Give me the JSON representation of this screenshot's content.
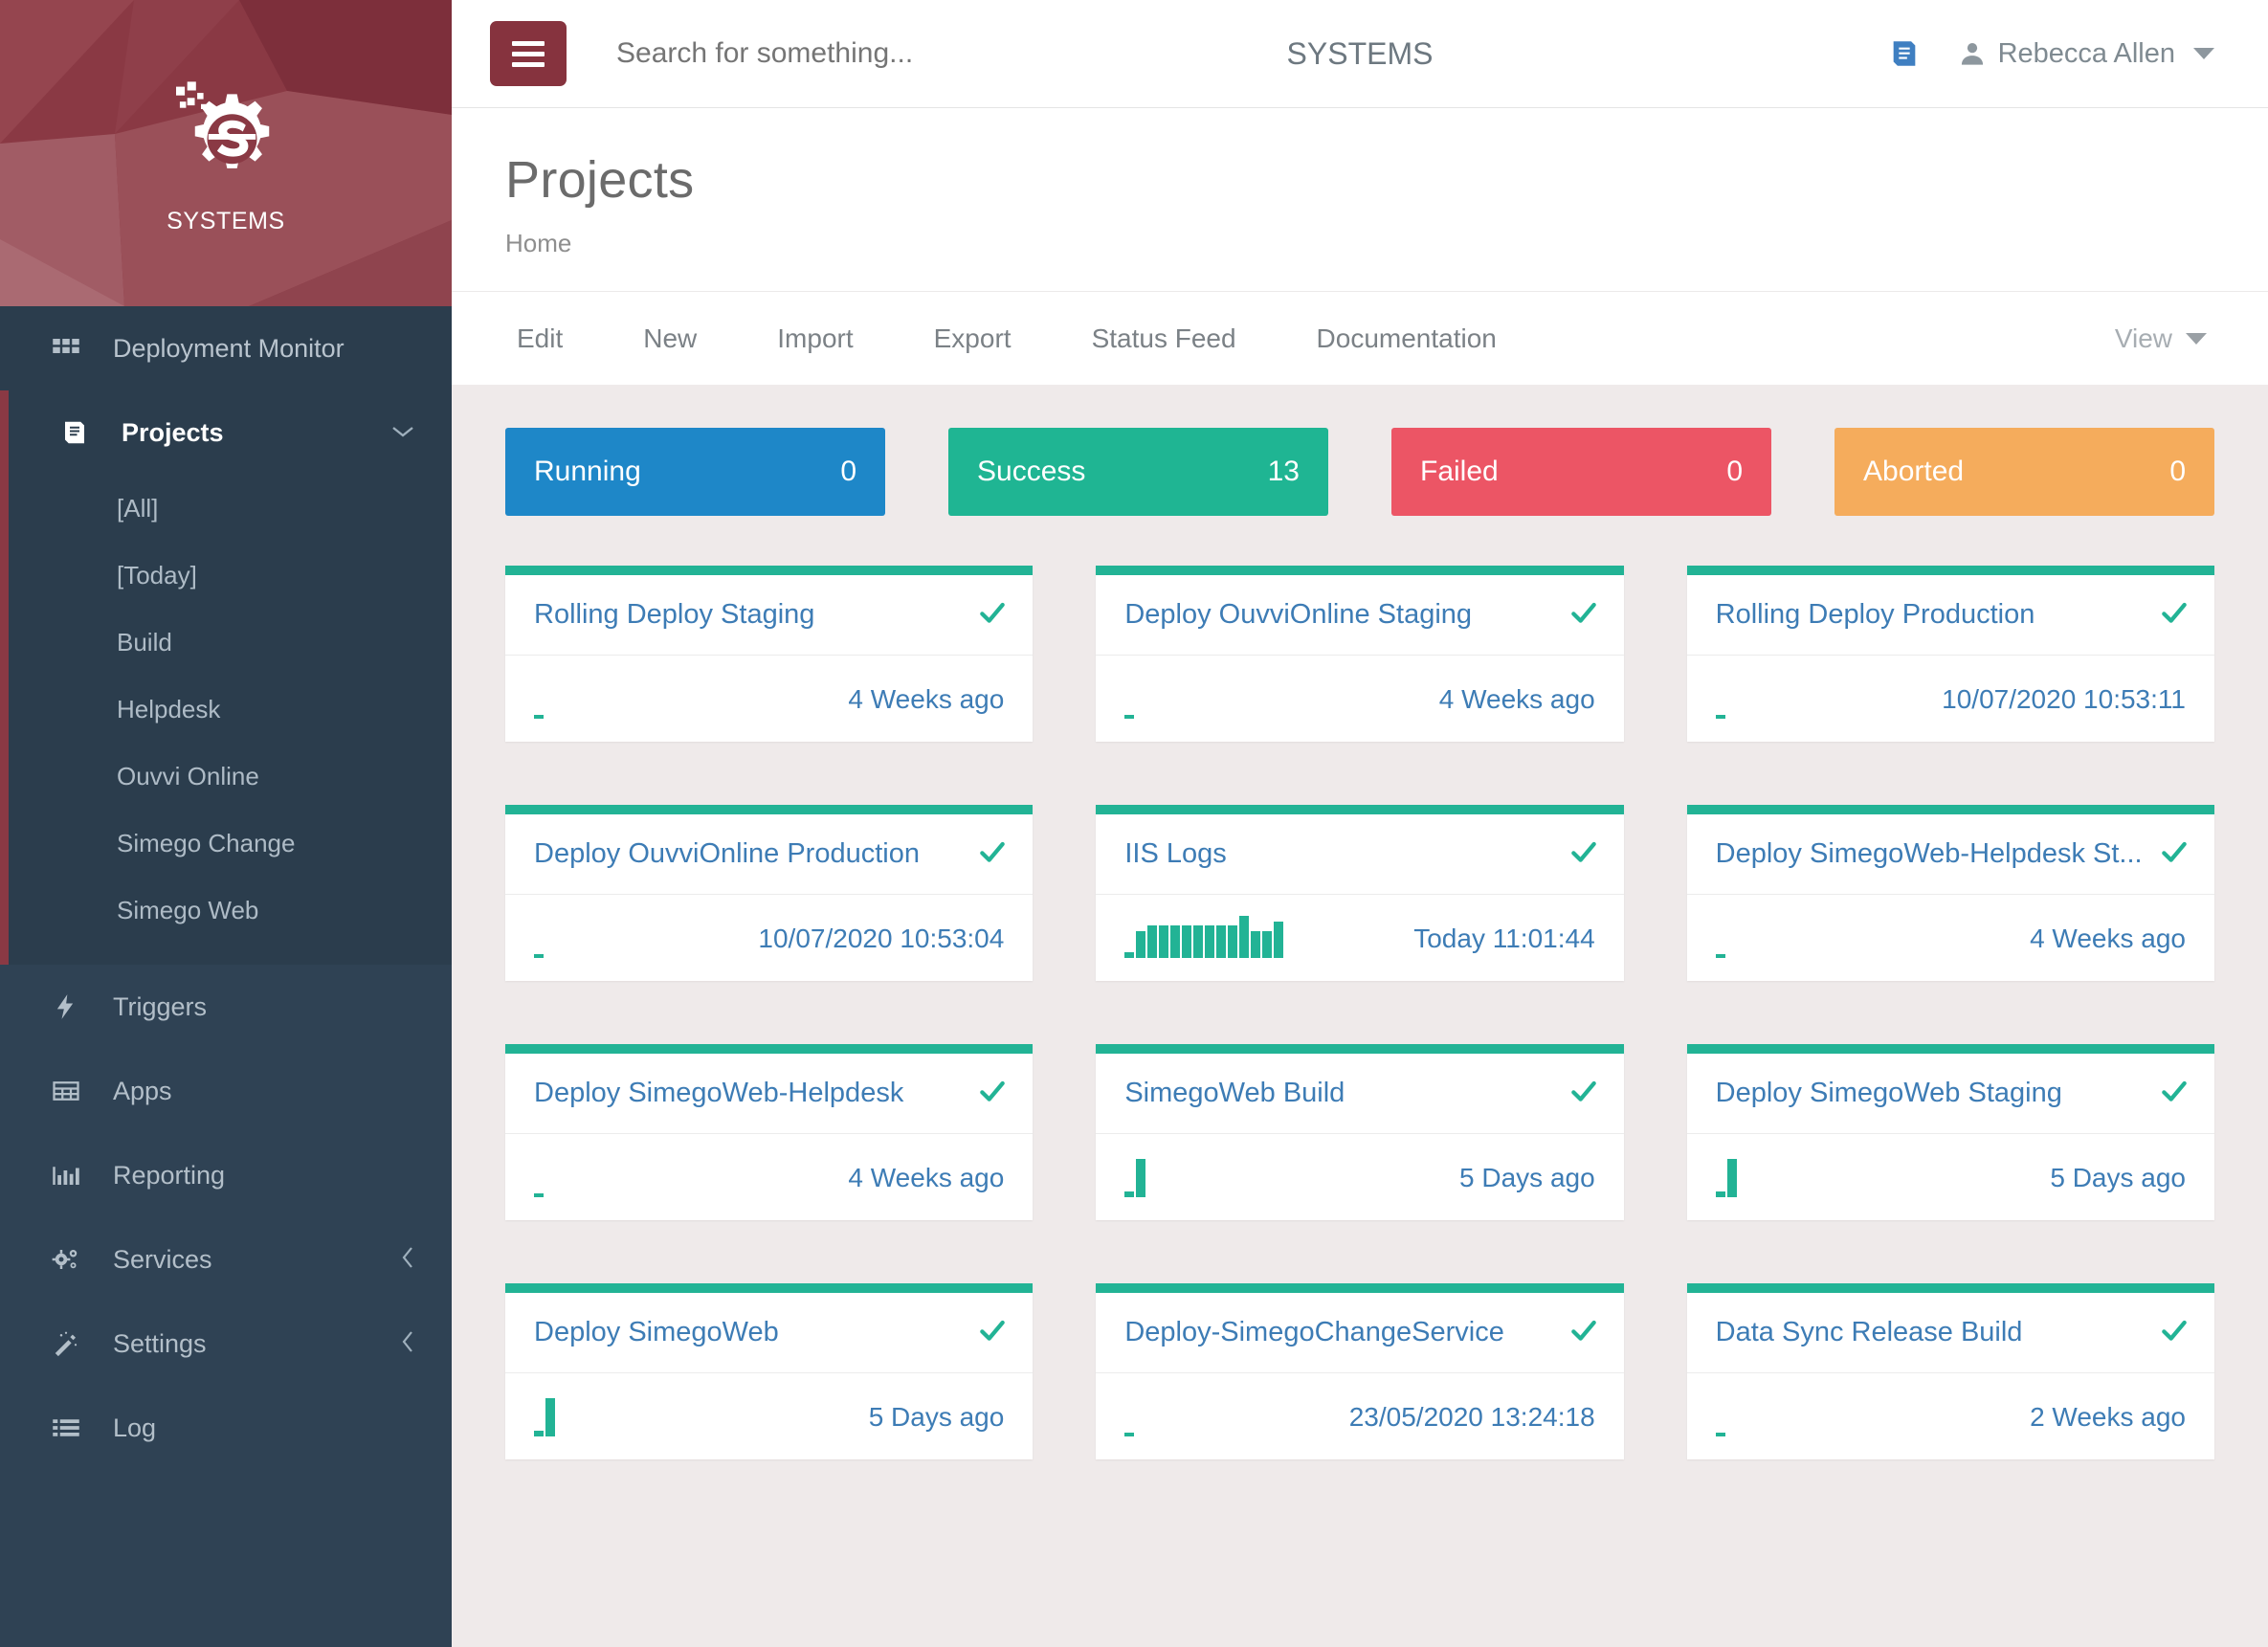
{
  "brand": {
    "name": "SYSTEMS",
    "logo_icon": "gear-s-logo"
  },
  "topbar": {
    "menu_icon": "hamburger-icon",
    "search_placeholder": "Search for something...",
    "search_value": "",
    "center_title": "SYSTEMS",
    "book_icon": "book-icon",
    "user_icon": "user-icon",
    "user_name": "Rebecca Allen",
    "caret_icon": "chevron-down-icon"
  },
  "sidebar": {
    "monitor": {
      "label": "Deployment Monitor",
      "icon": "grid-icon"
    },
    "projects": {
      "label": "Projects",
      "icon": "book-icon",
      "chevron": "chevron-down-icon"
    },
    "project_items": [
      {
        "label": "[All]"
      },
      {
        "label": "[Today]"
      },
      {
        "label": "Build"
      },
      {
        "label": "Helpdesk"
      },
      {
        "label": "Ouvvi Online"
      },
      {
        "label": "Simego Change"
      },
      {
        "label": "Simego Web"
      }
    ],
    "items": [
      {
        "label": "Triggers",
        "icon": "bolt-icon",
        "chevron": ""
      },
      {
        "label": "Apps",
        "icon": "table-icon",
        "chevron": ""
      },
      {
        "label": "Reporting",
        "icon": "bar-chart-icon",
        "chevron": ""
      },
      {
        "label": "Services",
        "icon": "gears-icon",
        "chevron": "chevron-left-icon"
      },
      {
        "label": "Settings",
        "icon": "wand-icon",
        "chevron": "chevron-left-icon"
      },
      {
        "label": "Log",
        "icon": "list-icon",
        "chevron": ""
      }
    ]
  },
  "page": {
    "title": "Projects",
    "breadcrumb": "Home"
  },
  "toolbar": {
    "items": [
      {
        "label": "Edit"
      },
      {
        "label": "New"
      },
      {
        "label": "Import"
      },
      {
        "label": "Export"
      },
      {
        "label": "Status Feed"
      },
      {
        "label": "Documentation"
      }
    ],
    "view_label": "View",
    "view_caret_icon": "chevron-down-icon"
  },
  "status_tiles": [
    {
      "label": "Running",
      "count": "0",
      "color": "#1e87c8"
    },
    {
      "label": "Success",
      "count": "13",
      "color": "#1fb593"
    },
    {
      "label": "Failed",
      "count": "0",
      "color": "#ec5565"
    },
    {
      "label": "Aborted",
      "count": "0",
      "color": "#f5ac5c"
    }
  ],
  "accent": {
    "maroon": "#8a3944",
    "sidebar": "#2f4254",
    "green": "#22b395",
    "link_blue": "#3d7cb5"
  },
  "projects": [
    {
      "title": "Rolling Deploy Staging",
      "time": "4 Weeks ago",
      "status": "success",
      "status_icon": "check-icon",
      "spark": [
        4
      ]
    },
    {
      "title": "Deploy OuvviOnline Staging",
      "time": "4 Weeks ago",
      "status": "success",
      "status_icon": "check-icon",
      "spark": [
        4
      ]
    },
    {
      "title": "Rolling Deploy Production",
      "time": "10/07/2020 10:53:11",
      "status": "success",
      "status_icon": "check-icon",
      "spark": [
        4
      ]
    },
    {
      "title": "Deploy OuvviOnline Production",
      "time": "10/07/2020 10:53:04",
      "status": "success",
      "status_icon": "check-icon",
      "spark": [
        4
      ]
    },
    {
      "title": "IIS Logs",
      "time": "Today 11:01:44",
      "status": "success",
      "status_icon": "check-icon",
      "spark": [
        6,
        28,
        34,
        34,
        34,
        34,
        34,
        34,
        34,
        34,
        44,
        28,
        28,
        38
      ]
    },
    {
      "title": "Deploy SimegoWeb-Helpdesk St...",
      "time": "4 Weeks ago",
      "status": "success",
      "status_icon": "check-icon",
      "spark": [
        4
      ]
    },
    {
      "title": "Deploy SimegoWeb-Helpdesk",
      "time": "4 Weeks ago",
      "status": "success",
      "status_icon": "check-icon",
      "spark": [
        4
      ]
    },
    {
      "title": "SimegoWeb Build",
      "time": "5 Days ago",
      "status": "success",
      "status_icon": "check-icon",
      "spark": [
        6,
        40
      ]
    },
    {
      "title": "Deploy SimegoWeb Staging",
      "time": "5 Days ago",
      "status": "success",
      "status_icon": "check-icon",
      "spark": [
        6,
        40
      ]
    },
    {
      "title": "Deploy SimegoWeb",
      "time": "5 Days ago",
      "status": "success",
      "status_icon": "check-icon",
      "spark": [
        6,
        40
      ]
    },
    {
      "title": "Deploy-SimegoChangeService",
      "time": "23/05/2020 13:24:18",
      "status": "success",
      "status_icon": "check-icon",
      "spark": [
        4
      ]
    },
    {
      "title": "Data Sync Release Build",
      "time": "2 Weeks ago",
      "status": "success",
      "status_icon": "check-icon",
      "spark": [
        4
      ]
    }
  ]
}
